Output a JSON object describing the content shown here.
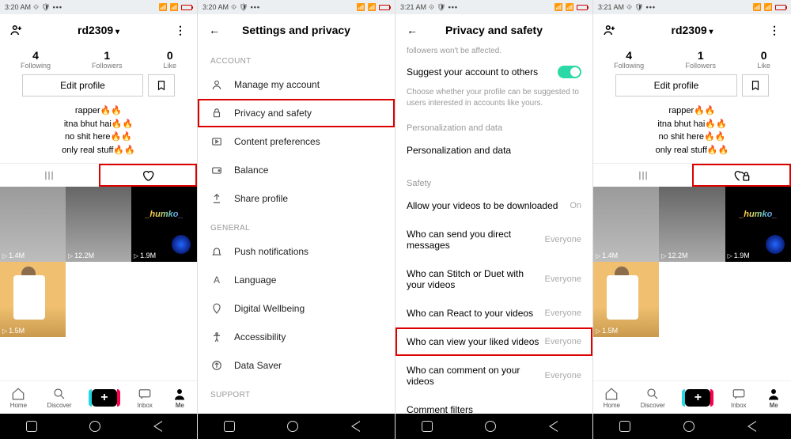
{
  "status": {
    "time1": "3:20 AM",
    "time2": "3:20 AM",
    "time3": "3:21 AM",
    "time4": "3:21 AM"
  },
  "profile": {
    "username": "rd2309",
    "stats": {
      "following_n": "4",
      "following_l": "Following",
      "followers_n": "1",
      "followers_l": "Followers",
      "like_n": "0",
      "like_l": "Like"
    },
    "edit": "Edit profile",
    "bio": {
      "l1": "rapper",
      "l2": "itna bhut hai",
      "l3": "no shit here",
      "l4": "only real stuff"
    },
    "videos": [
      "1.4M",
      "12.2M",
      "1.9M",
      "1.5M"
    ],
    "thumb_text": "_humko_"
  },
  "settings": {
    "title": "Settings and privacy",
    "account_hdr": "ACCOUNT",
    "items_account": [
      "Manage my account",
      "Privacy and safety",
      "Content preferences",
      "Balance",
      "Share profile"
    ],
    "general_hdr": "GENERAL",
    "items_general": [
      "Push notifications",
      "Language",
      "Digital Wellbeing",
      "Accessibility",
      "Data Saver"
    ],
    "support_hdr": "SUPPORT"
  },
  "privacy": {
    "title": "Privacy and safety",
    "desc_pre": "followers won't be affected.",
    "suggest": "Suggest your account to others",
    "suggest_desc": "Choose whether your profile can be suggested to users interested in accounts like yours.",
    "pers_hdr": "Personalization and data",
    "pers": "Personalization and data",
    "safety_hdr": "Safety",
    "rows": [
      {
        "l": "Allow your videos to be downloaded",
        "v": "On"
      },
      {
        "l": "Who can send you direct messages",
        "v": "Everyone"
      },
      {
        "l": "Who can Stitch or Duet with your videos",
        "v": "Everyone"
      },
      {
        "l": "Who can React to your videos",
        "v": "Everyone"
      },
      {
        "l": "Who can view your liked videos",
        "v": "Everyone"
      },
      {
        "l": "Who can comment on your videos",
        "v": "Everyone"
      },
      {
        "l": "Comment filters",
        "v": ""
      }
    ]
  },
  "bottomnav": {
    "home": "Home",
    "discover": "Discover",
    "inbox": "Inbox",
    "me": "Me"
  }
}
